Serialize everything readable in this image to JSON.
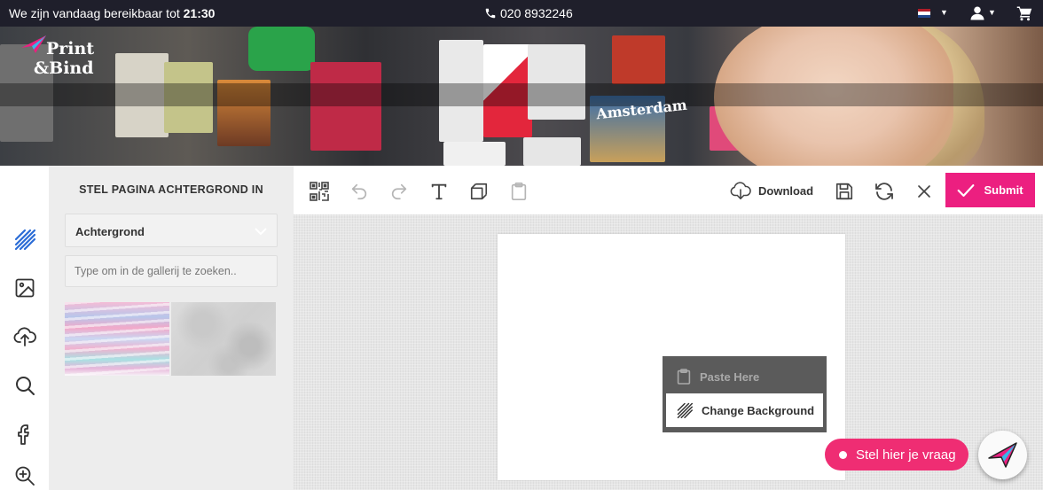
{
  "topbar": {
    "hours_text": "We zijn vandaag bereikbaar tot ",
    "hours_time": "21:30",
    "phone": "020 8932246"
  },
  "banner": {
    "logo_line1": "Print",
    "logo_line2": "&Bind",
    "postcard_text": "Amsterdam"
  },
  "panel": {
    "title": "STEL PAGINA ACHTERGROND IN",
    "select_value": "Achtergrond",
    "search_placeholder": "Type om in de gallerij te zoeken.."
  },
  "toolbar": {
    "download_label": "Download",
    "submit_label": "Submit"
  },
  "context_menu": {
    "paste_label": "Paste Here",
    "change_bg_label": "Change Background"
  },
  "chat": {
    "label": "Stel hier je vraag"
  },
  "colors": {
    "topbar": "#1f1f2b",
    "accent": "#ec1f80",
    "chat": "#ef2d73",
    "rail_icon_active": "#2b6cd6"
  },
  "icons": {
    "rail": [
      "background-pattern-icon",
      "image-icon",
      "upload-icon",
      "search-icon",
      "facebook-icon",
      "zoom-in-icon"
    ],
    "toolbar": [
      "qr-code-icon",
      "undo-icon",
      "redo-icon",
      "text-icon",
      "layers-icon",
      "clipboard-icon",
      "download-icon",
      "save-icon",
      "refresh-icon",
      "close-icon",
      "check-icon"
    ]
  }
}
